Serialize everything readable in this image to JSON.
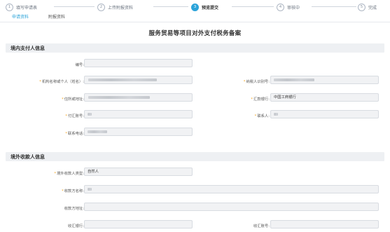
{
  "stepper": {
    "steps": [
      {
        "num": "1",
        "label": "填写申请表"
      },
      {
        "num": "2",
        "label": "上传附报资料"
      },
      {
        "num": "3",
        "label": "预览提交"
      },
      {
        "num": "4",
        "label": "审核中"
      },
      {
        "num": "5",
        "label": "完成"
      }
    ],
    "active_index": 2
  },
  "tabs": [
    {
      "label": "申请资料"
    },
    {
      "label": "附报资料"
    }
  ],
  "page_title": "服务贸易等项目对外支付税务备案",
  "section1": {
    "title": "境内支付人信息",
    "fields": {
      "number": {
        "label": "编号:",
        "value": ""
      },
      "org_name": {
        "label": "机构名称或个人（姓名）:",
        "value": ""
      },
      "taxpayer_id": {
        "label": "纳税人识别号:",
        "value": ""
      },
      "address": {
        "label": "住所或地址:",
        "value": ""
      },
      "remit_bank": {
        "label": "汇款银行:",
        "value": "中国工商银行"
      },
      "payment_account": {
        "label": "付汇账号:",
        "value": ""
      },
      "contact_person": {
        "label": "联系人:",
        "value": ""
      },
      "contact_phone": {
        "label": "联系电话:",
        "value": ""
      }
    }
  },
  "section2": {
    "title": "境外收款人信息",
    "fields": {
      "payee_type": {
        "label": "境外收款人类型:",
        "value": "自然人"
      },
      "payee_name": {
        "label": "收款方名称:",
        "value": ""
      },
      "payee_address": {
        "label": "收款方地址:",
        "value": ""
      },
      "receiving_bank": {
        "label": "收汇银行:",
        "value": ""
      },
      "receiving_account": {
        "label": "收汇账号:",
        "value": ""
      }
    }
  },
  "colors": {
    "accent": "#2ba3d9",
    "required": "#f5a623",
    "section_bg": "#eef0f3"
  }
}
